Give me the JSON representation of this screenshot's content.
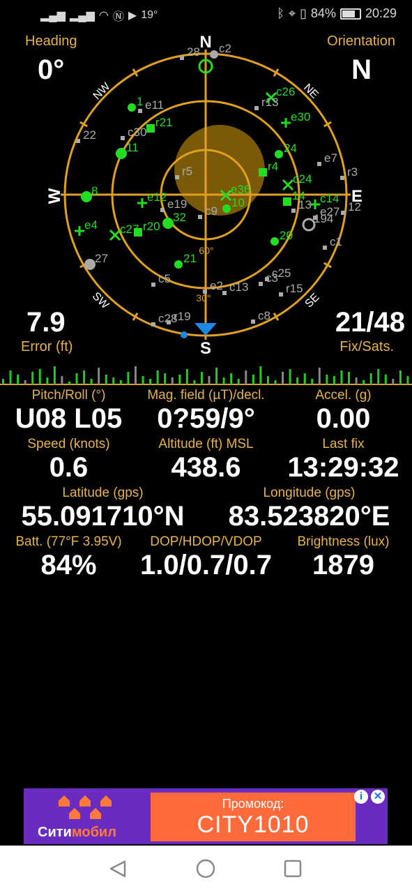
{
  "status_bar": {
    "left_text": "19°",
    "battery": "84%",
    "battery_level": 0.84,
    "time": "20:29"
  },
  "header": {
    "heading_label": "Heading",
    "heading_value": "0°",
    "orientation_label": "Orientation",
    "orientation_value": "N",
    "error_value": "7.9",
    "error_label": "Error (ft)",
    "fix_value": "21/48",
    "fix_label": "Fix/Sats."
  },
  "compass": {
    "N": "N",
    "S": "S",
    "E": "E",
    "W": "W",
    "NE": "NE",
    "NW": "NW",
    "SE": "SE",
    "SW": "SW",
    "ring_60": "60°",
    "ring_30": "30°",
    "ring_color": "#e0a020",
    "used_color": "#22dd22",
    "unused_color": "#aaaaaa"
  },
  "satellites": [
    {
      "id": "1",
      "mark": "dot",
      "used": true
    },
    {
      "id": "e11",
      "mark": "sq",
      "used": false
    },
    {
      "id": "22",
      "mark": "sq",
      "used": false
    },
    {
      "id": "e30",
      "mark": "plus",
      "used": true
    },
    {
      "id": "c26",
      "mark": "x",
      "used": true
    },
    {
      "id": "r13",
      "mark": "sq",
      "used": false
    },
    {
      "id": "c30",
      "mark": "sq",
      "used": false
    },
    {
      "id": "r21",
      "mark": "sqbig",
      "used": true
    },
    {
      "id": "11",
      "mark": "dotbig",
      "used": true
    },
    {
      "id": "24",
      "mark": "dot",
      "used": true
    },
    {
      "id": "e7",
      "mark": "sq",
      "used": false
    },
    {
      "id": "r5",
      "mark": "sq",
      "used": false
    },
    {
      "id": "r4",
      "mark": "sqbig",
      "used": true
    },
    {
      "id": "r3",
      "mark": "sq",
      "used": false
    },
    {
      "id": "8",
      "mark": "dotbig",
      "used": true
    },
    {
      "id": "e12",
      "mark": "plus",
      "used": true
    },
    {
      "id": "e19",
      "mark": "sq",
      "used": false
    },
    {
      "id": "c24",
      "mark": "x",
      "used": true
    },
    {
      "id": "e36",
      "mark": "x",
      "used": true
    },
    {
      "id": "10",
      "mark": "dot",
      "used": true
    },
    {
      "id": "14",
      "mark": "sqbig",
      "used": true
    },
    {
      "id": "c14",
      "mark": "plus",
      "used": true
    },
    {
      "id": "c9",
      "mark": "sq",
      "used": false
    },
    {
      "id": "13",
      "mark": "sq",
      "used": false
    },
    {
      "id": "e27",
      "mark": "sq",
      "used": false
    },
    {
      "id": "12",
      "mark": "sq",
      "used": false
    },
    {
      "id": "194",
      "mark": "ring",
      "used": false
    },
    {
      "id": "e4",
      "mark": "plus",
      "used": true
    },
    {
      "id": "c27",
      "mark": "x",
      "used": true
    },
    {
      "id": "r20",
      "mark": "sqbig",
      "used": true
    },
    {
      "id": "32",
      "mark": "dotbig",
      "used": true
    },
    {
      "id": "20",
      "mark": "dot",
      "used": true
    },
    {
      "id": "c1",
      "mark": "sq",
      "used": false
    },
    {
      "id": "27",
      "mark": "dotbig",
      "used": false
    },
    {
      "id": "21",
      "mark": "dot",
      "used": true
    },
    {
      "id": "c5",
      "mark": "sq",
      "used": false
    },
    {
      "id": "c25",
      "mark": "sq",
      "used": false
    },
    {
      "id": "c3",
      "mark": "sq",
      "used": false
    },
    {
      "id": "r15",
      "mark": "sq",
      "used": false
    },
    {
      "id": "e2",
      "mark": "sq",
      "used": false
    },
    {
      "id": "c13",
      "mark": "sq",
      "used": false
    },
    {
      "id": "c28",
      "mark": "sq",
      "used": false
    },
    {
      "id": "r19",
      "mark": "sq",
      "used": false
    },
    {
      "id": "c8",
      "mark": "sq",
      "used": false
    },
    {
      "id": "28",
      "mark": "sq",
      "used": false
    },
    {
      "id": "c2",
      "mark": "dot",
      "used": false
    }
  ],
  "signal_bars": [
    8,
    20,
    14,
    6,
    18,
    22,
    10,
    26,
    12,
    4,
    16,
    20,
    8,
    24,
    14,
    10,
    6,
    18,
    26,
    12,
    8,
    20,
    16,
    10,
    14,
    22,
    6,
    18,
    12,
    24,
    10,
    16,
    8,
    20,
    14,
    26,
    12,
    6,
    18,
    22,
    10,
    16,
    8,
    24,
    14,
    12,
    20,
    18,
    10,
    6,
    16,
    22,
    14,
    8,
    20,
    12
  ],
  "data_grid": [
    {
      "title": "Pitch/Roll (°)",
      "value": "U08 L05"
    },
    {
      "title": "Mag. field (µT)/decl.",
      "value": "0?59/9°"
    },
    {
      "title": "Accel. (g)",
      "value": "0.00"
    },
    {
      "title": "Speed (knots)",
      "value": "0.6"
    },
    {
      "title": "Altitude (ft) MSL",
      "value": "438.6"
    },
    {
      "title": "Last fix",
      "value": "13:29:32"
    },
    {
      "title": "Latitude (gps)",
      "value": "55.091710°N"
    },
    {
      "title": "Longitude (gps)",
      "value": "83.523820°E"
    },
    {
      "title": "Batt. (77°F 3.95V)",
      "value": "84%"
    },
    {
      "title": "DOP/HDOP/VDOP",
      "value": "1.0/0.7/0.7"
    },
    {
      "title": "Brightness (lux)",
      "value": "1879"
    }
  ],
  "ad": {
    "promo_label": "Промокод:",
    "promo_code": "CITY1010",
    "brand_a": "Сити",
    "brand_b": "мобил",
    "info": "i",
    "close": "✕"
  }
}
